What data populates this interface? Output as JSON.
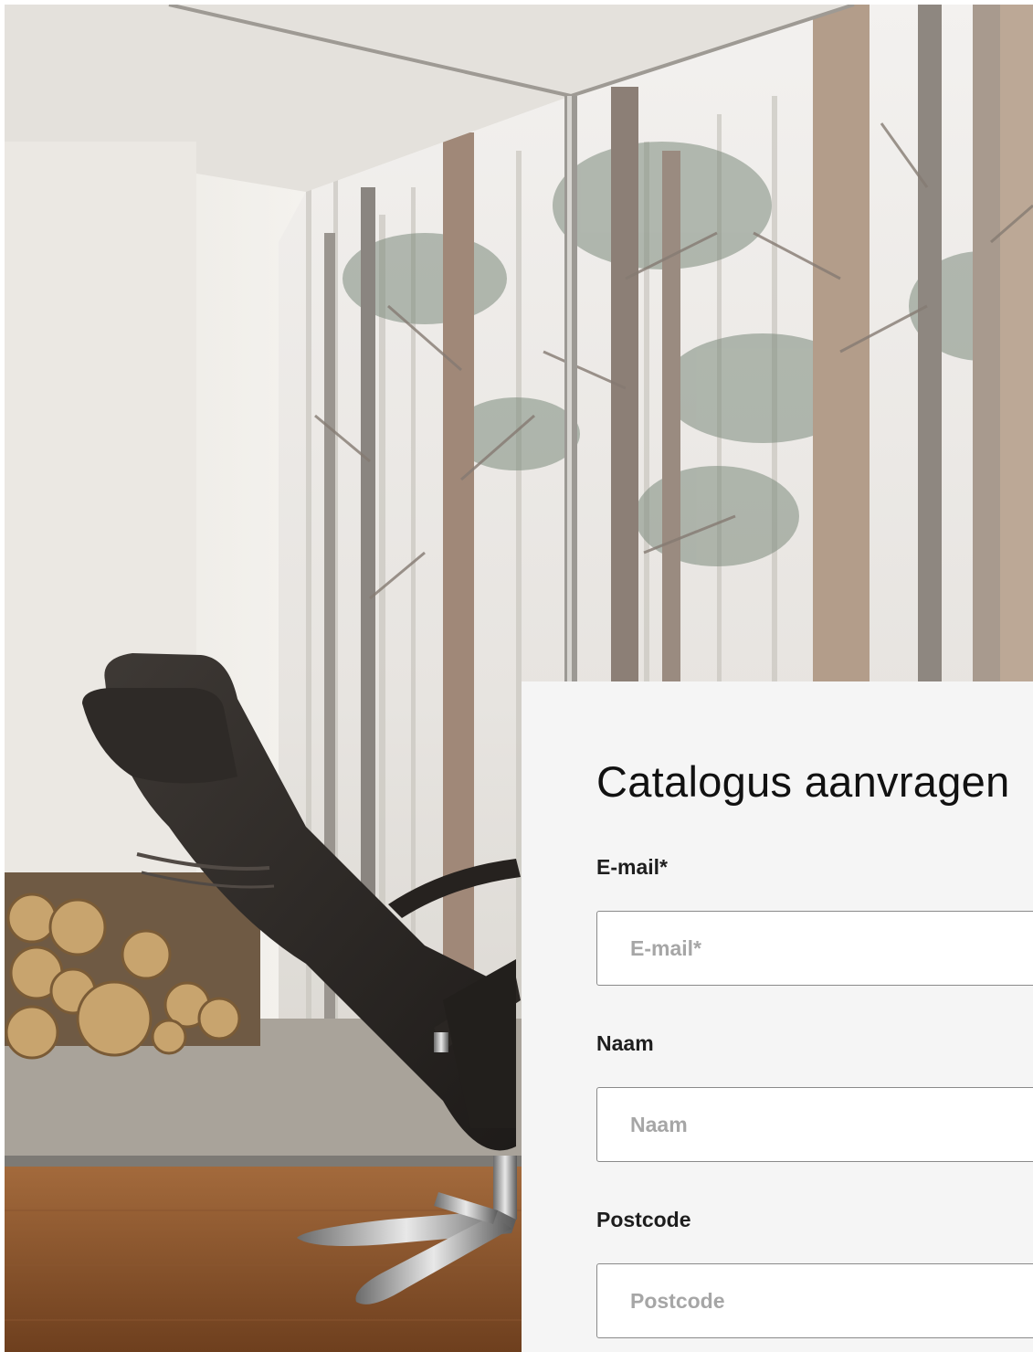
{
  "form": {
    "title": "Catalogus aanvragen",
    "fields": [
      {
        "label": "E-mail*",
        "placeholder": "E-mail*",
        "value": ""
      },
      {
        "label": "Naam",
        "placeholder": "Naam",
        "value": ""
      },
      {
        "label": "Postcode",
        "placeholder": "Postcode",
        "value": ""
      }
    ]
  },
  "colors": {
    "panel_background": "#f5f5f5",
    "input_border": "#8a8a8a",
    "title_text": "#111111",
    "placeholder_text": "#a6a6a6"
  },
  "icons": {
    "hero": "recliner-chair-forest-photo"
  }
}
